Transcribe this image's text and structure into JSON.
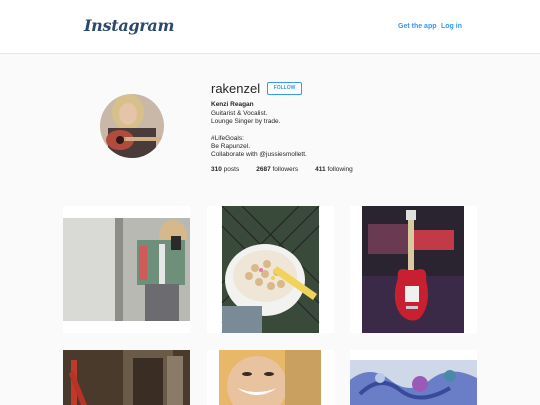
{
  "header": {
    "logo_text": "Instagram",
    "get_app_label": "Get the app",
    "login_label": "Log in"
  },
  "profile": {
    "username": "rakenzel",
    "follow_label": "FOLLOW",
    "full_name": "Kenzi Reagan",
    "bio": "Guitarist & Vocalist.\nLounge Singer by trade.\n\n#LifeGoals:\nBe Rapunzel.\nCollaborate with @jussiesmollett.",
    "stats": {
      "posts_count": "310",
      "posts_label": "posts",
      "followers_count": "2687",
      "followers_label": "followers",
      "following_count": "411",
      "following_label": "following"
    }
  },
  "colors": {
    "accent": "#3897f0",
    "header_bg": "#ffffff",
    "page_bg": "#fafafa"
  },
  "icons": {
    "avatar": "avatar-photo-guitar",
    "logo": "instagram-wordmark"
  },
  "posts": [
    {
      "subject": "mirror-selfie-plaid-shirt"
    },
    {
      "subject": "cereal-bowl-with-spoon"
    },
    {
      "subject": "red-electric-guitar"
    },
    {
      "subject": "red-guitar-in-room"
    },
    {
      "subject": "smiling-face-closeup"
    },
    {
      "subject": "blue-floral-art"
    }
  ]
}
